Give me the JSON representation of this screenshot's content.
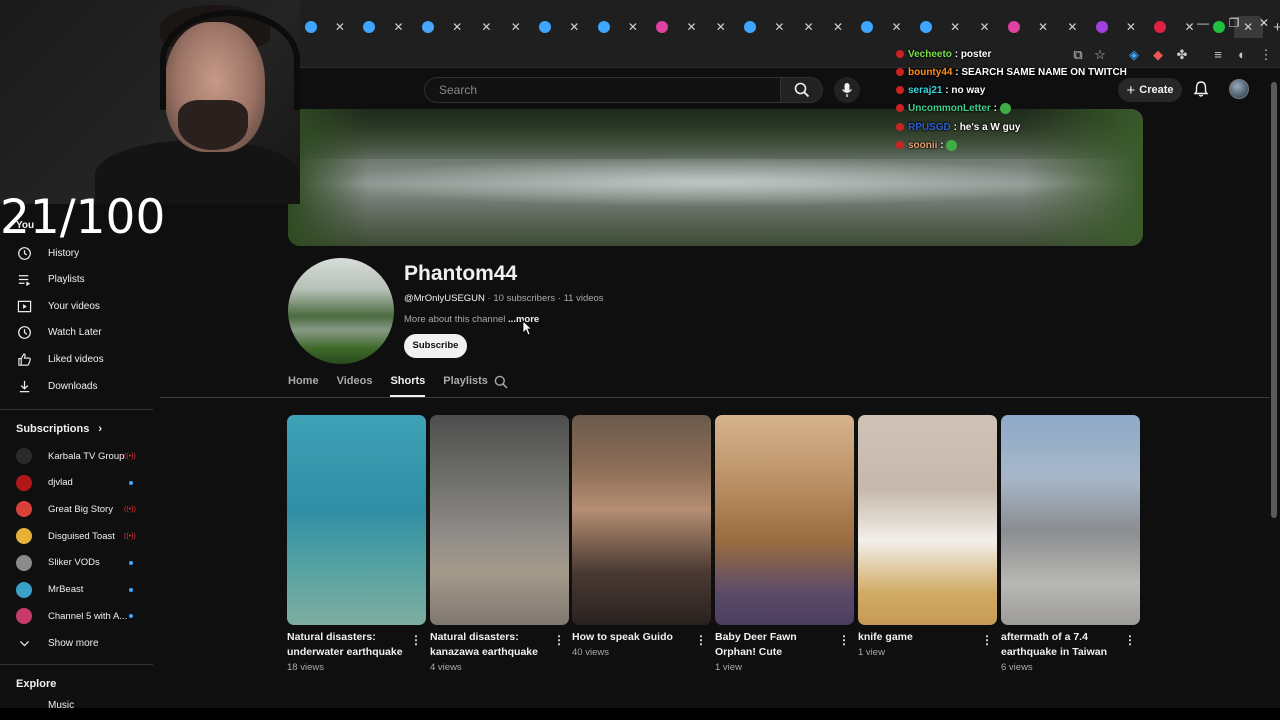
{
  "browser": {
    "tab_close_glyph": "✕",
    "new_tab_glyph": "+",
    "window_controls": [
      "—",
      "❐",
      "✕"
    ]
  },
  "youtube_header": {
    "search_placeholder": "Search",
    "create_label": "Create"
  },
  "channel": {
    "name": "Phantom44",
    "handle": "@MrOnlyUSEGUN",
    "subscribers": "10 subscribers",
    "videos": "11 videos",
    "separator": " · ",
    "about": "More about this channel",
    "more": "...more",
    "subscribe_label": "Subscribe"
  },
  "channel_tabs": [
    "Home",
    "Videos",
    "Shorts",
    "Playlists"
  ],
  "active_tab": "Shorts",
  "shorts": [
    {
      "title": "Natural disasters: underwater earthquake",
      "views": "18 views"
    },
    {
      "title": "Natural disasters: kanazawa earthquake",
      "views": "4 views"
    },
    {
      "title": "How to speak Guido",
      "views": "40 views"
    },
    {
      "title": "Baby Deer Fawn Orphan! Cute",
      "views": "1 view"
    },
    {
      "title": "knife game",
      "views": "1 view"
    },
    {
      "title": "aftermath  of a 7.4 earthquake in Taiwan",
      "views": "6 views"
    }
  ],
  "sidebar": {
    "you_partial": "You",
    "items": [
      {
        "label": "History",
        "icon": "history-icon"
      },
      {
        "label": "Playlists",
        "icon": "playlists-icon"
      },
      {
        "label": "Your videos",
        "icon": "your-videos-icon"
      },
      {
        "label": "Watch Later",
        "icon": "watch-later-icon"
      },
      {
        "label": "Liked videos",
        "icon": "thumbs-up-icon"
      },
      {
        "label": "Downloads",
        "icon": "download-icon"
      }
    ],
    "subscriptions_heading": "Subscriptions",
    "subscriptions": [
      {
        "name": "Karbala TV Group",
        "status": "live",
        "color": "#2b2b2b"
      },
      {
        "name": "djvlad",
        "status": "new",
        "color": "#b01818"
      },
      {
        "name": "Great Big Story",
        "status": "live",
        "color": "#d8413a"
      },
      {
        "name": "Disguised Toast",
        "status": "live",
        "color": "#e8b23a"
      },
      {
        "name": "Sliker VODs",
        "status": "new",
        "color": "#8a8a8a"
      },
      {
        "name": "MrBeast",
        "status": "new",
        "color": "#3aa0c8"
      },
      {
        "name": "Channel 5 with A...",
        "status": "new",
        "color": "#c83a6a"
      }
    ],
    "show_more": "Show more",
    "explore_heading": "Explore",
    "explore_partial": "Music"
  },
  "stream_overlay": {
    "counter": "21/100",
    "chat": [
      {
        "user": "Vecheeto",
        "color": "#7be04a",
        "message": "poster"
      },
      {
        "user": "bounty44",
        "color": "#ff8c1a",
        "message": "SEARCH SAME NAME ON TWITCH"
      },
      {
        "user": "seraj21",
        "color": "#3ad6e0",
        "message": "no way"
      },
      {
        "user": "UncommonLetter",
        "color": "#3fd08a",
        "message": ""
      },
      {
        "user": "RPUSGD",
        "color": "#2f5fd0",
        "message": "he's a W guy"
      },
      {
        "user": "soonii",
        "color": "#e0a070",
        "message": ""
      }
    ]
  },
  "colors": {
    "background": "#0f0f0f",
    "text_primary": "#f1f1f1",
    "text_secondary": "#aaaaaa",
    "live_red": "#e33333",
    "new_dot_blue": "#3ea6ff"
  }
}
